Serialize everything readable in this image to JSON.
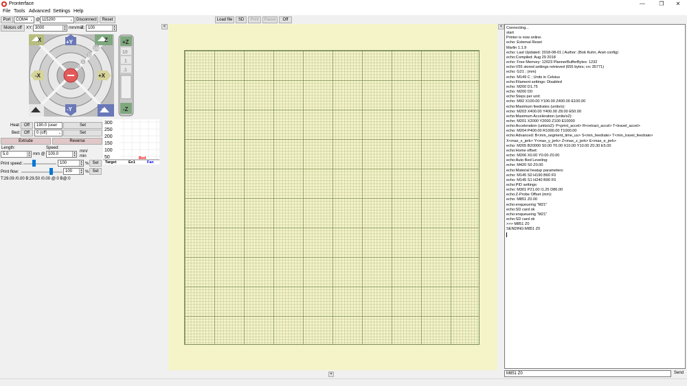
{
  "window": {
    "title": "Pronterface",
    "controls": [
      "—",
      "❐",
      "✕"
    ]
  },
  "menu": [
    "File",
    "Tools",
    "Advanced",
    "Settings",
    "Help"
  ],
  "toolbar": {
    "port_label": "Port",
    "port_value": "COM4",
    "at_label": "@",
    "baud_value": "115200",
    "disconnect_label": "Disconnect",
    "reset_label": "Reset",
    "load_file_label": "Load file",
    "sd_label": "SD",
    "print_label": "Print",
    "pause_label": "Pause",
    "off_label": "Off"
  },
  "motors": {
    "motors_off_label": "Motors off",
    "xy_label": "XY:",
    "xy_value": "3000",
    "speed_unit": "mm/min",
    "z_label": "Z:",
    "z_value": "100"
  },
  "jog": {
    "home_x": "X",
    "home_y": "Y",
    "home_z": "Z",
    "home_all": "",
    "plus_y": "+Y",
    "minus_y": "-Y",
    "plus_x": "+X",
    "minus_x": "-X",
    "rings": [
      "100",
      "10",
      "1",
      ".1"
    ],
    "z_plus": "+Z",
    "z_minus": "-Z",
    "z_steps": [
      "10",
      "1",
      ".1"
    ]
  },
  "temps": {
    "heat_label": "Heat:",
    "heat_off": "Off",
    "heat_value": "190.0 (user",
    "heat_set": "Set",
    "bed_label": "Bed:",
    "bed_off": "Off",
    "bed_value": "0 (off)",
    "bed_set": "Set",
    "extrude_label": "Extrude",
    "reverse_label": "Reverse",
    "length_label": "Length:",
    "length_value": "5.0",
    "length_unit": "mm @",
    "speed_label": "Speed:",
    "speed_value": "100.0",
    "speed_unit": "mm/\nmin",
    "print_speed_label": "Print speed:",
    "print_speed_value": "100",
    "print_speed_unit": "%",
    "print_speed_set": "Set",
    "print_flow_label": "Print flow:",
    "print_flow_value": "100",
    "print_flow_unit": "%",
    "print_flow_set": "Set",
    "status_line": "T:29.09 /0.00 B:29.50 /0.00 @:0 B@:0"
  },
  "chart_data": {
    "type": "line",
    "y_ticks": [
      "300",
      "250",
      "200",
      "150",
      "100",
      "50"
    ],
    "legend": [
      {
        "name": "Target",
        "color": "#000000"
      },
      {
        "name": "Ex1",
        "color": "#000000"
      },
      {
        "name": "Bed",
        "color": "#ff0000"
      },
      {
        "name": "Fan",
        "color": "#0000ff"
      }
    ]
  },
  "console": {
    "lines": [
      "Connecting...",
      "start",
      "Printer is now online.",
      "echo: External Reset",
      "Marlin 1.1.9",
      "echo: Last Updated: 2018-08-01 | Author: (Bob Kuhn, Anet config)",
      "echo:Compiled: Aug 29 2018",
      "echo: Free Memory: 12023  PlannerBufferBytes: 1232",
      "echo:V55 stored settings retrieved (655 bytes; crc 35771)",
      "echo:  G21    ; (mm)",
      "echo:  M149 C ; Units in Celsius",
      "echo:Filament settings: Disabled",
      "echo:  M200 D1.75",
      "echo:  M200 D0",
      "echo:Steps per unit:",
      "echo:  M92 X100.00 Y100.00 Z400.00 E100.00",
      "echo:Maximum feedrates (units/s):",
      "echo:  M203 X400.00 Y400.00 Z8.00 E50.00",
      "echo:Maximum Acceleration (units/s2):",
      "echo:  M201 X2000 Y2000 Z100 E10000",
      "echo:Acceleration (units/s2): P<print_accel> R<retract_accel> T<travel_accel>",
      "echo:  M204 P400.00 R1000.00 T1000.00",
      "echo:Advanced: B<min_segment_time_us> S<min_feedrate> T<min_travel_feedrate>",
      "X<max_x_jerk> Y<max_y_jerk> Z<max_z_jerk> E<max_e_jerk>",
      "echo:  M205 B20000 S0.00 T0.00 X10.00 Y10.00 Z0.30 E5.00",
      "echo:Home offset:",
      "echo:  M206 X0.00 Y0.00 Z0.00",
      "echo:Auto Bed Leveling:",
      "echo:  M420 S0 Z0.00",
      "echo:Material heatup parameters:",
      "echo:  M145 S0 H190 B60 F0",
      "echo:  M145 S1 H240 B90 F0",
      "echo:PID settings:",
      "echo:  M301 P21.00 I1.25 D86.00",
      "echo:Z-Probe Offset (mm):",
      "echo:  M851 Z0.00",
      "echo:enqueueing \"M21\"",
      "echo:SD card ok",
      "echo:enqueueing \"M21\"",
      "echo:SD card ok",
      ">>> M851 Z0",
      "SENDING:M851 Z0"
    ],
    "input_value": "M851 Z0",
    "send_label": "Send"
  },
  "panels": {
    "collapse_left": "<",
    "collapse_right": "<",
    "expand_bottom": "+"
  }
}
